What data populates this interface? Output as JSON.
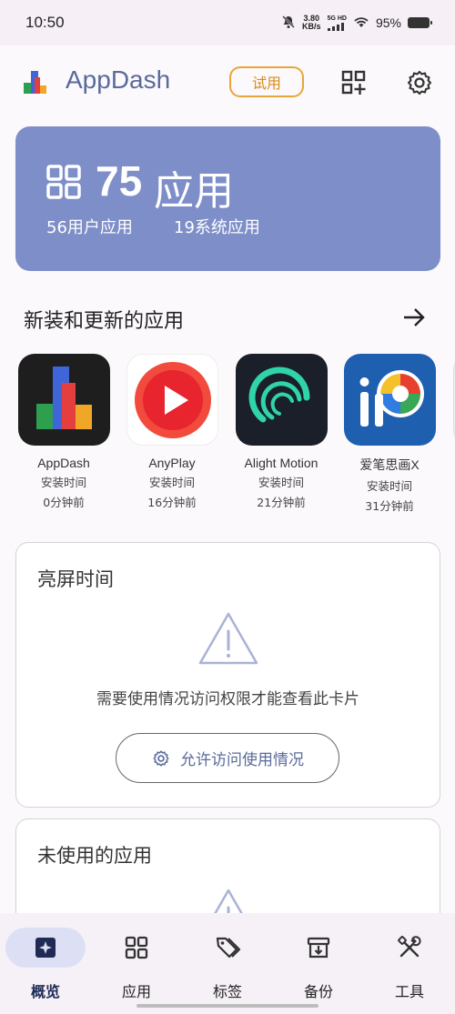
{
  "status_bar": {
    "time": "10:50",
    "net_speed": "3.80",
    "net_unit": "KB/s",
    "net_type_top": "5G HD",
    "battery": "95%"
  },
  "header": {
    "app_name": "AppDash",
    "trial_label": "试用"
  },
  "summary": {
    "total_count": "75",
    "total_label": "应用",
    "user_apps": "56用户应用",
    "system_apps": "19系统应用",
    "color": "#7e8ec8"
  },
  "recent": {
    "title": "新装和更新的应用",
    "apps": [
      {
        "name": "AppDash",
        "status": "安装时间",
        "time": "0分钟前"
      },
      {
        "name": "AnyPlay",
        "status": "安装时间",
        "time": "16分钟前"
      },
      {
        "name": "Alight Motion",
        "status": "安装时间",
        "time": "21分钟前"
      },
      {
        "name": "爱笔思画X",
        "status": "安装时间",
        "time": "31分钟前"
      }
    ]
  },
  "screen_time_card": {
    "title": "亮屏时间",
    "message": "需要使用情况访问权限才能查看此卡片",
    "button_label": "允许访问使用情况"
  },
  "unused_card": {
    "title": "未使用的应用"
  },
  "bottom_nav": {
    "items": [
      {
        "label": "概览",
        "icon": "sparkle-icon",
        "active": true
      },
      {
        "label": "应用",
        "icon": "grid-icon",
        "active": false
      },
      {
        "label": "标签",
        "icon": "tag-icon",
        "active": false
      },
      {
        "label": "备份",
        "icon": "archive-icon",
        "active": false
      },
      {
        "label": "工具",
        "icon": "tools-icon",
        "active": false
      }
    ]
  },
  "colors": {
    "accent": "#5b6a9c",
    "trial": "#e9a53a",
    "nav_active": "#dde0f4"
  }
}
